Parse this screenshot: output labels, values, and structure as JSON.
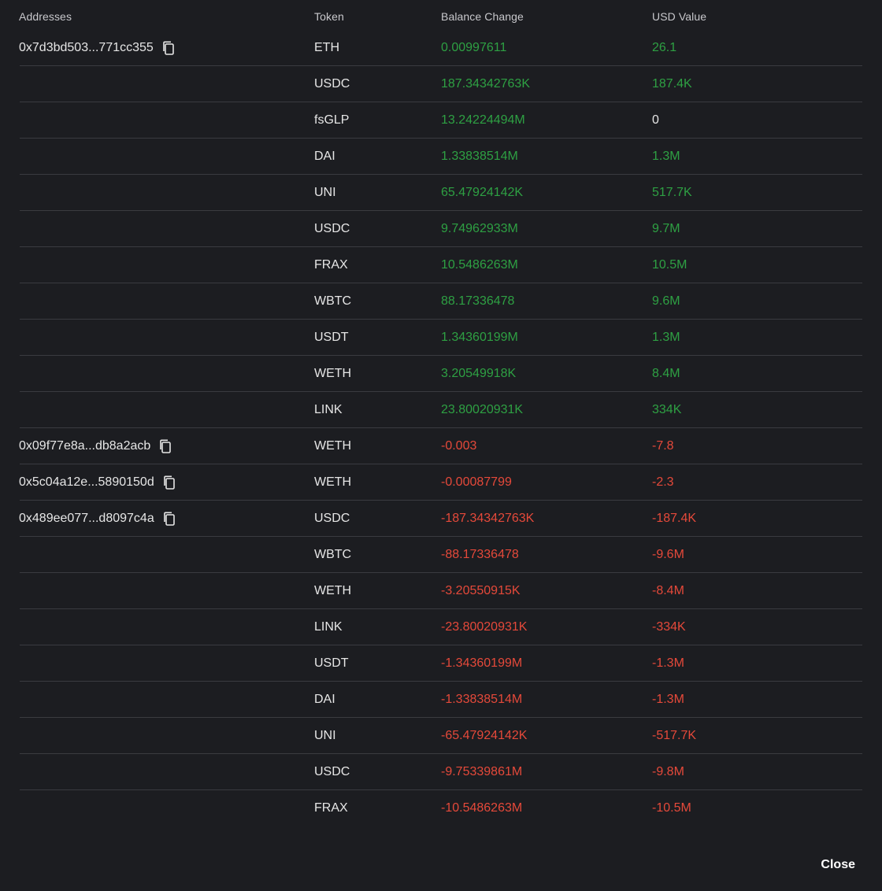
{
  "header": {
    "addresses": "Addresses",
    "token": "Token",
    "balance_change": "Balance Change",
    "usd_value": "USD Value"
  },
  "colors": {
    "positive": "#2ea043",
    "negative": "#e5493a",
    "neutral": "#e6e6e6",
    "background": "#1c1d21"
  },
  "rows": [
    {
      "address": "0x7d3bd503...771cc355",
      "token": "ETH",
      "balance": "0.00997611",
      "usd": "26.1",
      "bal_sign": "pos",
      "usd_sign": "pos"
    },
    {
      "address": "",
      "token": "USDC",
      "balance": "187.34342763K",
      "usd": "187.4K",
      "bal_sign": "pos",
      "usd_sign": "pos"
    },
    {
      "address": "",
      "token": "fsGLP",
      "balance": "13.24224494M",
      "usd": "0",
      "bal_sign": "pos",
      "usd_sign": "neutral"
    },
    {
      "address": "",
      "token": "DAI",
      "balance": "1.33838514M",
      "usd": "1.3M",
      "bal_sign": "pos",
      "usd_sign": "pos"
    },
    {
      "address": "",
      "token": "UNI",
      "balance": "65.47924142K",
      "usd": "517.7K",
      "bal_sign": "pos",
      "usd_sign": "pos"
    },
    {
      "address": "",
      "token": "USDC",
      "balance": "9.74962933M",
      "usd": "9.7M",
      "bal_sign": "pos",
      "usd_sign": "pos"
    },
    {
      "address": "",
      "token": "FRAX",
      "balance": "10.5486263M",
      "usd": "10.5M",
      "bal_sign": "pos",
      "usd_sign": "pos"
    },
    {
      "address": "",
      "token": "WBTC",
      "balance": "88.17336478",
      "usd": "9.6M",
      "bal_sign": "pos",
      "usd_sign": "pos"
    },
    {
      "address": "",
      "token": "USDT",
      "balance": "1.34360199M",
      "usd": "1.3M",
      "bal_sign": "pos",
      "usd_sign": "pos"
    },
    {
      "address": "",
      "token": "WETH",
      "balance": "3.20549918K",
      "usd": "8.4M",
      "bal_sign": "pos",
      "usd_sign": "pos"
    },
    {
      "address": "",
      "token": "LINK",
      "balance": "23.80020931K",
      "usd": "334K",
      "bal_sign": "pos",
      "usd_sign": "pos"
    },
    {
      "address": "0x09f77e8a...db8a2acb",
      "token": "WETH",
      "balance": "-0.003",
      "usd": "-7.8",
      "bal_sign": "neg",
      "usd_sign": "neg"
    },
    {
      "address": "0x5c04a12e...5890150d",
      "token": "WETH",
      "balance": "-0.00087799",
      "usd": "-2.3",
      "bal_sign": "neg",
      "usd_sign": "neg"
    },
    {
      "address": "0x489ee077...d8097c4a",
      "token": "USDC",
      "balance": "-187.34342763K",
      "usd": "-187.4K",
      "bal_sign": "neg",
      "usd_sign": "neg"
    },
    {
      "address": "",
      "token": "WBTC",
      "balance": "-88.17336478",
      "usd": "-9.6M",
      "bal_sign": "neg",
      "usd_sign": "neg"
    },
    {
      "address": "",
      "token": "WETH",
      "balance": "-3.20550915K",
      "usd": "-8.4M",
      "bal_sign": "neg",
      "usd_sign": "neg"
    },
    {
      "address": "",
      "token": "LINK",
      "balance": "-23.80020931K",
      "usd": "-334K",
      "bal_sign": "neg",
      "usd_sign": "neg"
    },
    {
      "address": "",
      "token": "USDT",
      "balance": "-1.34360199M",
      "usd": "-1.3M",
      "bal_sign": "neg",
      "usd_sign": "neg"
    },
    {
      "address": "",
      "token": "DAI",
      "balance": "-1.33838514M",
      "usd": "-1.3M",
      "bal_sign": "neg",
      "usd_sign": "neg"
    },
    {
      "address": "",
      "token": "UNI",
      "balance": "-65.47924142K",
      "usd": "-517.7K",
      "bal_sign": "neg",
      "usd_sign": "neg"
    },
    {
      "address": "",
      "token": "USDC",
      "balance": "-9.75339861M",
      "usd": "-9.8M",
      "bal_sign": "neg",
      "usd_sign": "neg"
    },
    {
      "address": "",
      "token": "FRAX",
      "balance": "-10.5486263M",
      "usd": "-10.5M",
      "bal_sign": "neg",
      "usd_sign": "neg"
    }
  ],
  "footer": {
    "close_label": "Close"
  }
}
